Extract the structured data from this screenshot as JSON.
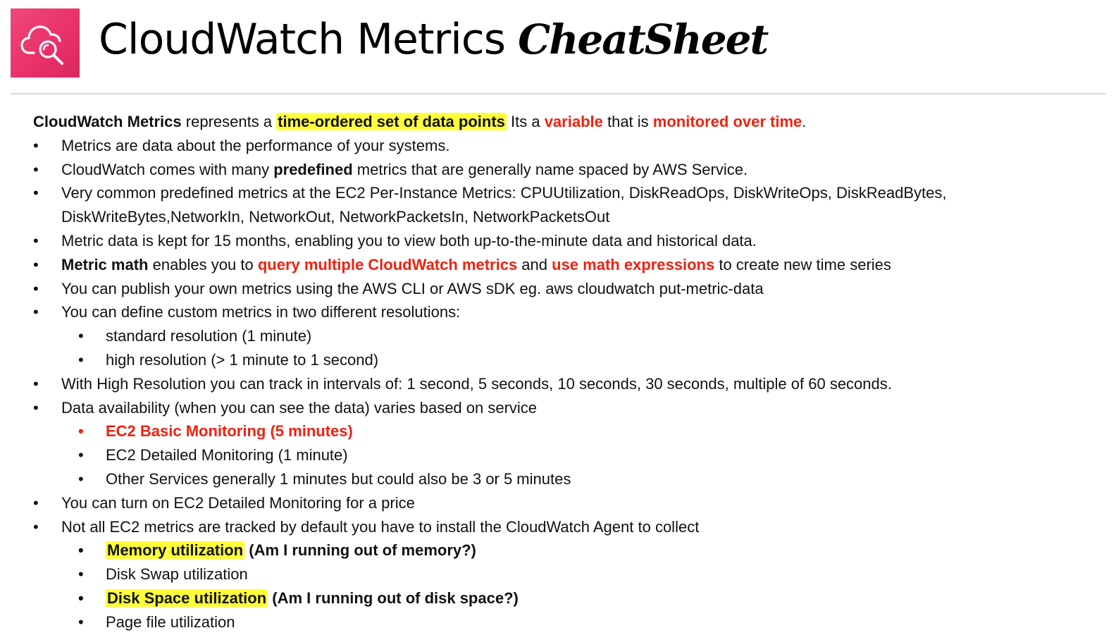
{
  "header": {
    "title_regular": "CloudWatch Metrics",
    "title_bold": "CheatSheet",
    "logo_icon": "cloudwatch-icon",
    "logo_color": "#e8306a"
  },
  "intro": {
    "term": "CloudWatch Metrics",
    "text1": " represents a ",
    "highlight": "time-ordered set of data points",
    "text2": "  Its a ",
    "red1": "variable",
    "text3": " that is ",
    "red2": "monitored over time",
    "text4": "."
  },
  "bullets": {
    "b1": "Metrics are data about the performance of your systems.",
    "b2_pre": "CloudWatch comes with many ",
    "b2_bold": "predefined",
    "b2_post": " metrics that are generally name spaced by AWS Service.",
    "b3": "Very common predefined metrics at the EC2 Per-Instance Metrics: CPUUtilization, DiskReadOps, DiskWriteOps, DiskReadBytes, DiskWriteBytes,NetworkIn, NetworkOut, NetworkPacketsIn, NetworkPacketsOut",
    "b4": "Metric data is kept for 15 months, enabling you to view both up-to-the-minute data and historical data.",
    "b5_bold": "Metric math",
    "b5_t1": " enables you to ",
    "b5_red1": "query multiple CloudWatch metrics",
    "b5_t2": " and ",
    "b5_red2": "use math expressions",
    "b5_t3": " to create new time series",
    "b6": "You can publish your own metrics using the AWS CLI or AWS sDK eg. aws cloudwatch put-metric-data",
    "b7": "You can define custom metrics in two different resolutions:",
    "b7_sub1": "standard resolution  (1 minute)",
    "b7_sub2": "high resolution (> 1 minute to 1 second)",
    "b8": "With High Resolution you can track in intervals of: 1 second, 5 seconds, 10 seconds, 30 seconds, multiple of 60 seconds.",
    "b9": "Data availability (when you can see the data) varies based on service",
    "b9_sub1": "EC2 Basic Monitoring (5 minutes)",
    "b9_sub2": "EC2 Detailed Monitoring (1 minute)",
    "b9_sub3": "Other Services generally 1 minutes but could also be 3 or 5 minutes",
    "b10": "You can turn on EC2 Detailed Monitoring for a price",
    "b11": "Not all EC2 metrics are tracked by default you have to install the CloudWatch Agent to collect",
    "b11_sub1_hl": "Memory utilization",
    "b11_sub1_post": " (Am I running out of memory?)",
    "b11_sub2": "Disk Swap utilization",
    "b11_sub3_hl": "Disk Space utilization",
    "b11_sub3_post": " (Am I running out of disk space?)",
    "b11_sub4": "Page file utilization"
  },
  "colors": {
    "red": "#ee2211",
    "highlight": "#ffff3a"
  }
}
